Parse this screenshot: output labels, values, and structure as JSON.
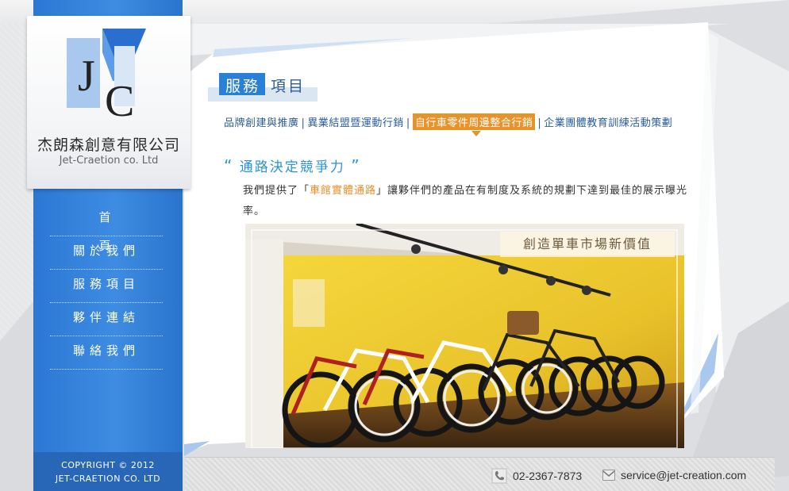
{
  "brand": {
    "logo_alt": "JC",
    "name_cn": "杰朗森創意有限公司",
    "name_en": "Jet-Craetion co. Ltd"
  },
  "nav": {
    "items": [
      {
        "label": "首頁"
      },
      {
        "label": "關於我們"
      },
      {
        "label": "服務項目"
      },
      {
        "label": "夥伴連結"
      },
      {
        "label": "聯絡我們"
      }
    ]
  },
  "copyright": {
    "line1": "COPYRIGHT © 2012",
    "line2": "JET-CRAETION CO. LTD"
  },
  "page": {
    "title_highlight": "服務",
    "title_rest": "項目"
  },
  "subnav": {
    "items": [
      {
        "label": "品牌創建與推廣",
        "active": false
      },
      {
        "label": "異業結盟暨運動行銷",
        "active": false
      },
      {
        "label": "自行車零件周邊整合行銷",
        "active": true
      },
      {
        "label": "企業團體教育訓練活動策劃",
        "active": false
      }
    ],
    "separator": "|"
  },
  "content": {
    "quote_open": "“",
    "heading": "通路決定競爭力",
    "quote_close": "”",
    "text_before": "我們提供了「",
    "text_highlight": "車館實體通路",
    "text_after": "」讓夥伴們的產品在有制度及系統的規劃下達到最佳的展示曝光率。",
    "photo_caption": "創造單車市場新價值"
  },
  "footer": {
    "phone": "02-2367-7873",
    "email": "service@jet-creation.com"
  },
  "colors": {
    "sidebar_blue": "#3a88de",
    "accent_orange": "#e8932a",
    "title_blue": "#2a7fd6",
    "link_blue": "#2b5d9b"
  },
  "icons": {
    "phone": "phone-icon",
    "mail": "mail-icon"
  }
}
